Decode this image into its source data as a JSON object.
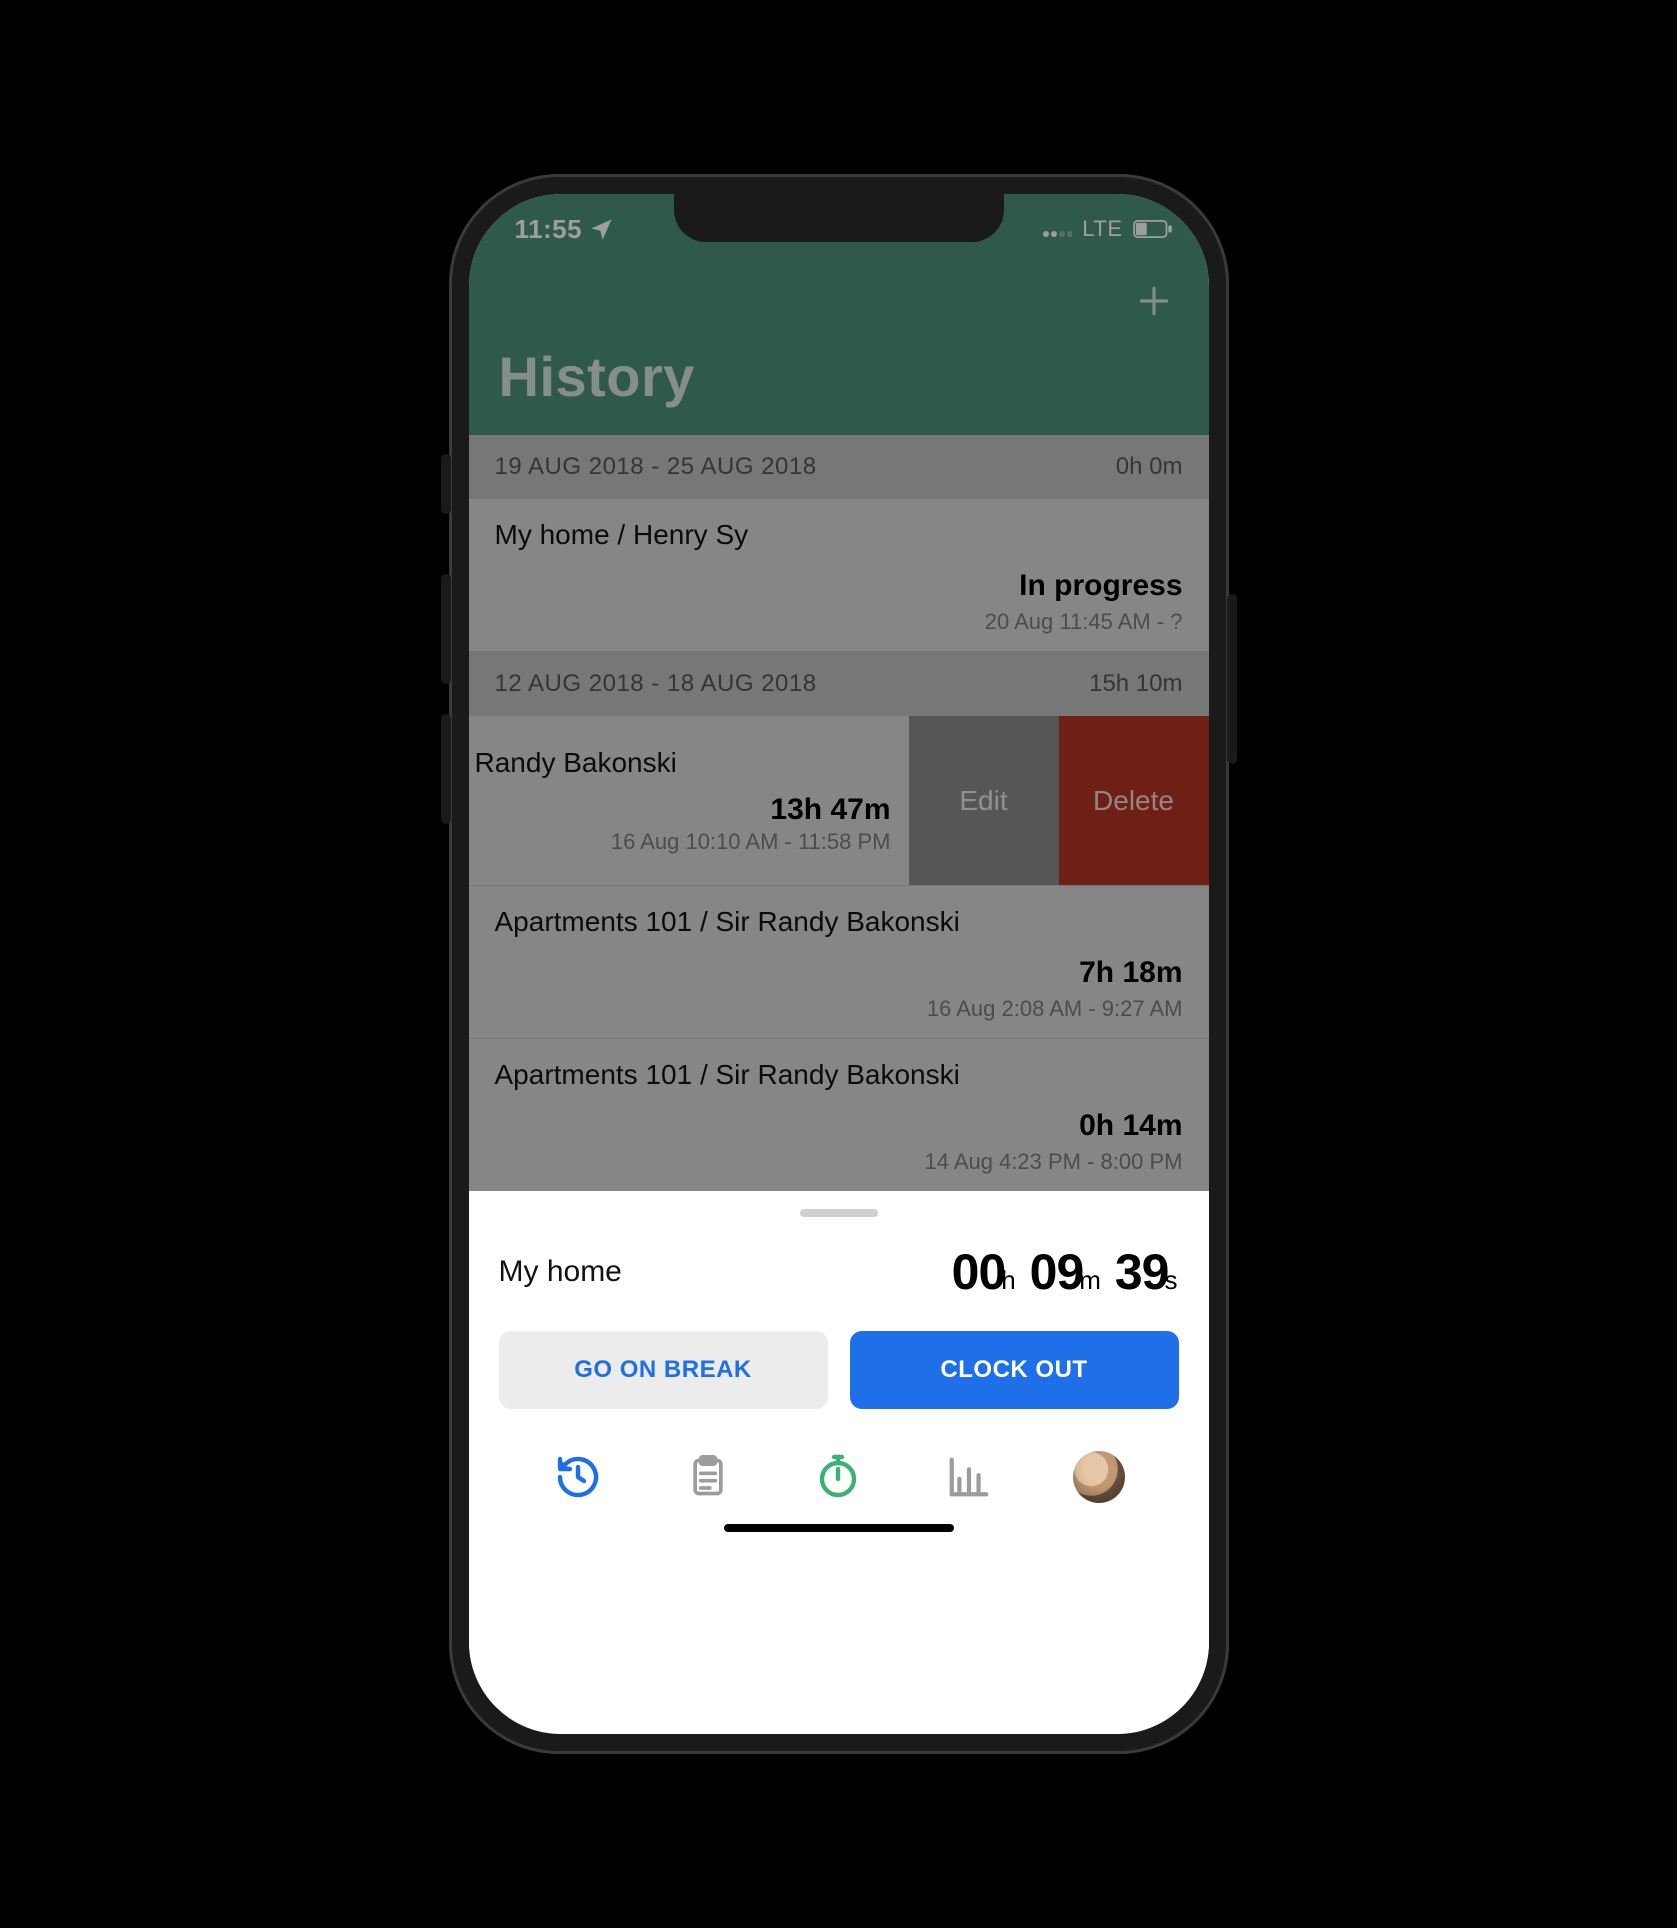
{
  "statusbar": {
    "time": "11:55",
    "network_label": "LTE"
  },
  "header": {
    "title": "History"
  },
  "sections": [
    {
      "label": "19 AUG 2018 - 25 AUG 2018",
      "total": "0h 0m",
      "entries": [
        {
          "title": "My home / Henry Sy",
          "duration": "In progress",
          "range": "20 Aug 11:45 AM - ?"
        }
      ]
    },
    {
      "label": "12 AUG 2018 - 18 AUG 2018",
      "total": "15h 10m",
      "entries": [
        {
          "title": "Randy Bakonski",
          "duration": "13h 47m",
          "range": "16 Aug 10:10 AM - 11:58 PM",
          "swiped": true,
          "actions": {
            "edit": "Edit",
            "delete": "Delete"
          }
        },
        {
          "title": "Apartments 101 / Sir Randy Bakonski",
          "duration": "7h 18m",
          "range": "16 Aug 2:08 AM - 9:27 AM"
        },
        {
          "title": "Apartments 101 / Sir Randy Bakonski",
          "duration": "0h 14m",
          "range": "14 Aug 4:23 PM - 8:00 PM"
        }
      ]
    }
  ],
  "bottom": {
    "location": "My home",
    "timer": {
      "h": "00",
      "m": "09",
      "s": "39"
    },
    "buttons": {
      "break": "GO ON BREAK",
      "clockout": "CLOCK OUT"
    }
  },
  "tabs": {
    "icons": [
      "history-icon",
      "clipboard-icon",
      "stopwatch-icon",
      "chart-icon",
      "avatar"
    ]
  },
  "colors": {
    "header_bg": "#4c8f74",
    "primary_blue": "#1f6fe8",
    "delete_red": "#b23224",
    "edit_gray": "#8b8b8b"
  }
}
